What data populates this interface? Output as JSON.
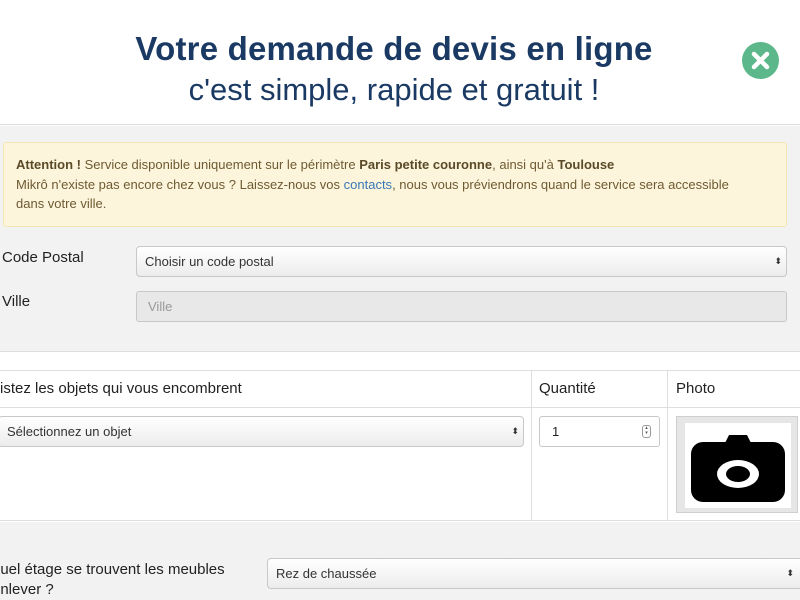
{
  "header": {
    "title": "Votre demande de devis en ligne",
    "subtitle": "c'est simple, rapide et gratuit !",
    "close_icon": "close-icon"
  },
  "alert": {
    "attention": "Attention !",
    "text1": " Service disponible uniquement sur le périmètre ",
    "zone": "Paris petite couronne",
    "text2": ", ainsi qu'à ",
    "city": "Toulouse",
    "text3": "Mikrô n'existe pas encore chez vous ? Laissez-nous vos ",
    "link": "contacts",
    "text4": ", nous vous préviendrons quand le service sera accessible",
    "text5": "dans votre ville."
  },
  "form": {
    "postal_label": "Code Postal",
    "postal_value": "Choisir un code postal",
    "city_label": "Ville",
    "city_placeholder": "Ville"
  },
  "items": {
    "col_objects": "istez les objets qui vous encombrent",
    "col_quantity": "Quantité",
    "col_photo": "Photo",
    "object_value": "Sélectionnez un objet",
    "quantity_value": "1",
    "photo_icon": "camera-icon"
  },
  "floor": {
    "label_line1": "quel étage se trouvent les meubles",
    "label_line2": "enlever ?",
    "value": "Rez de chaussée"
  },
  "colors": {
    "title": "#1b3a63",
    "close_button": "#5cb88a",
    "alert_bg": "#fcf5dc",
    "link": "#3a78b5"
  }
}
